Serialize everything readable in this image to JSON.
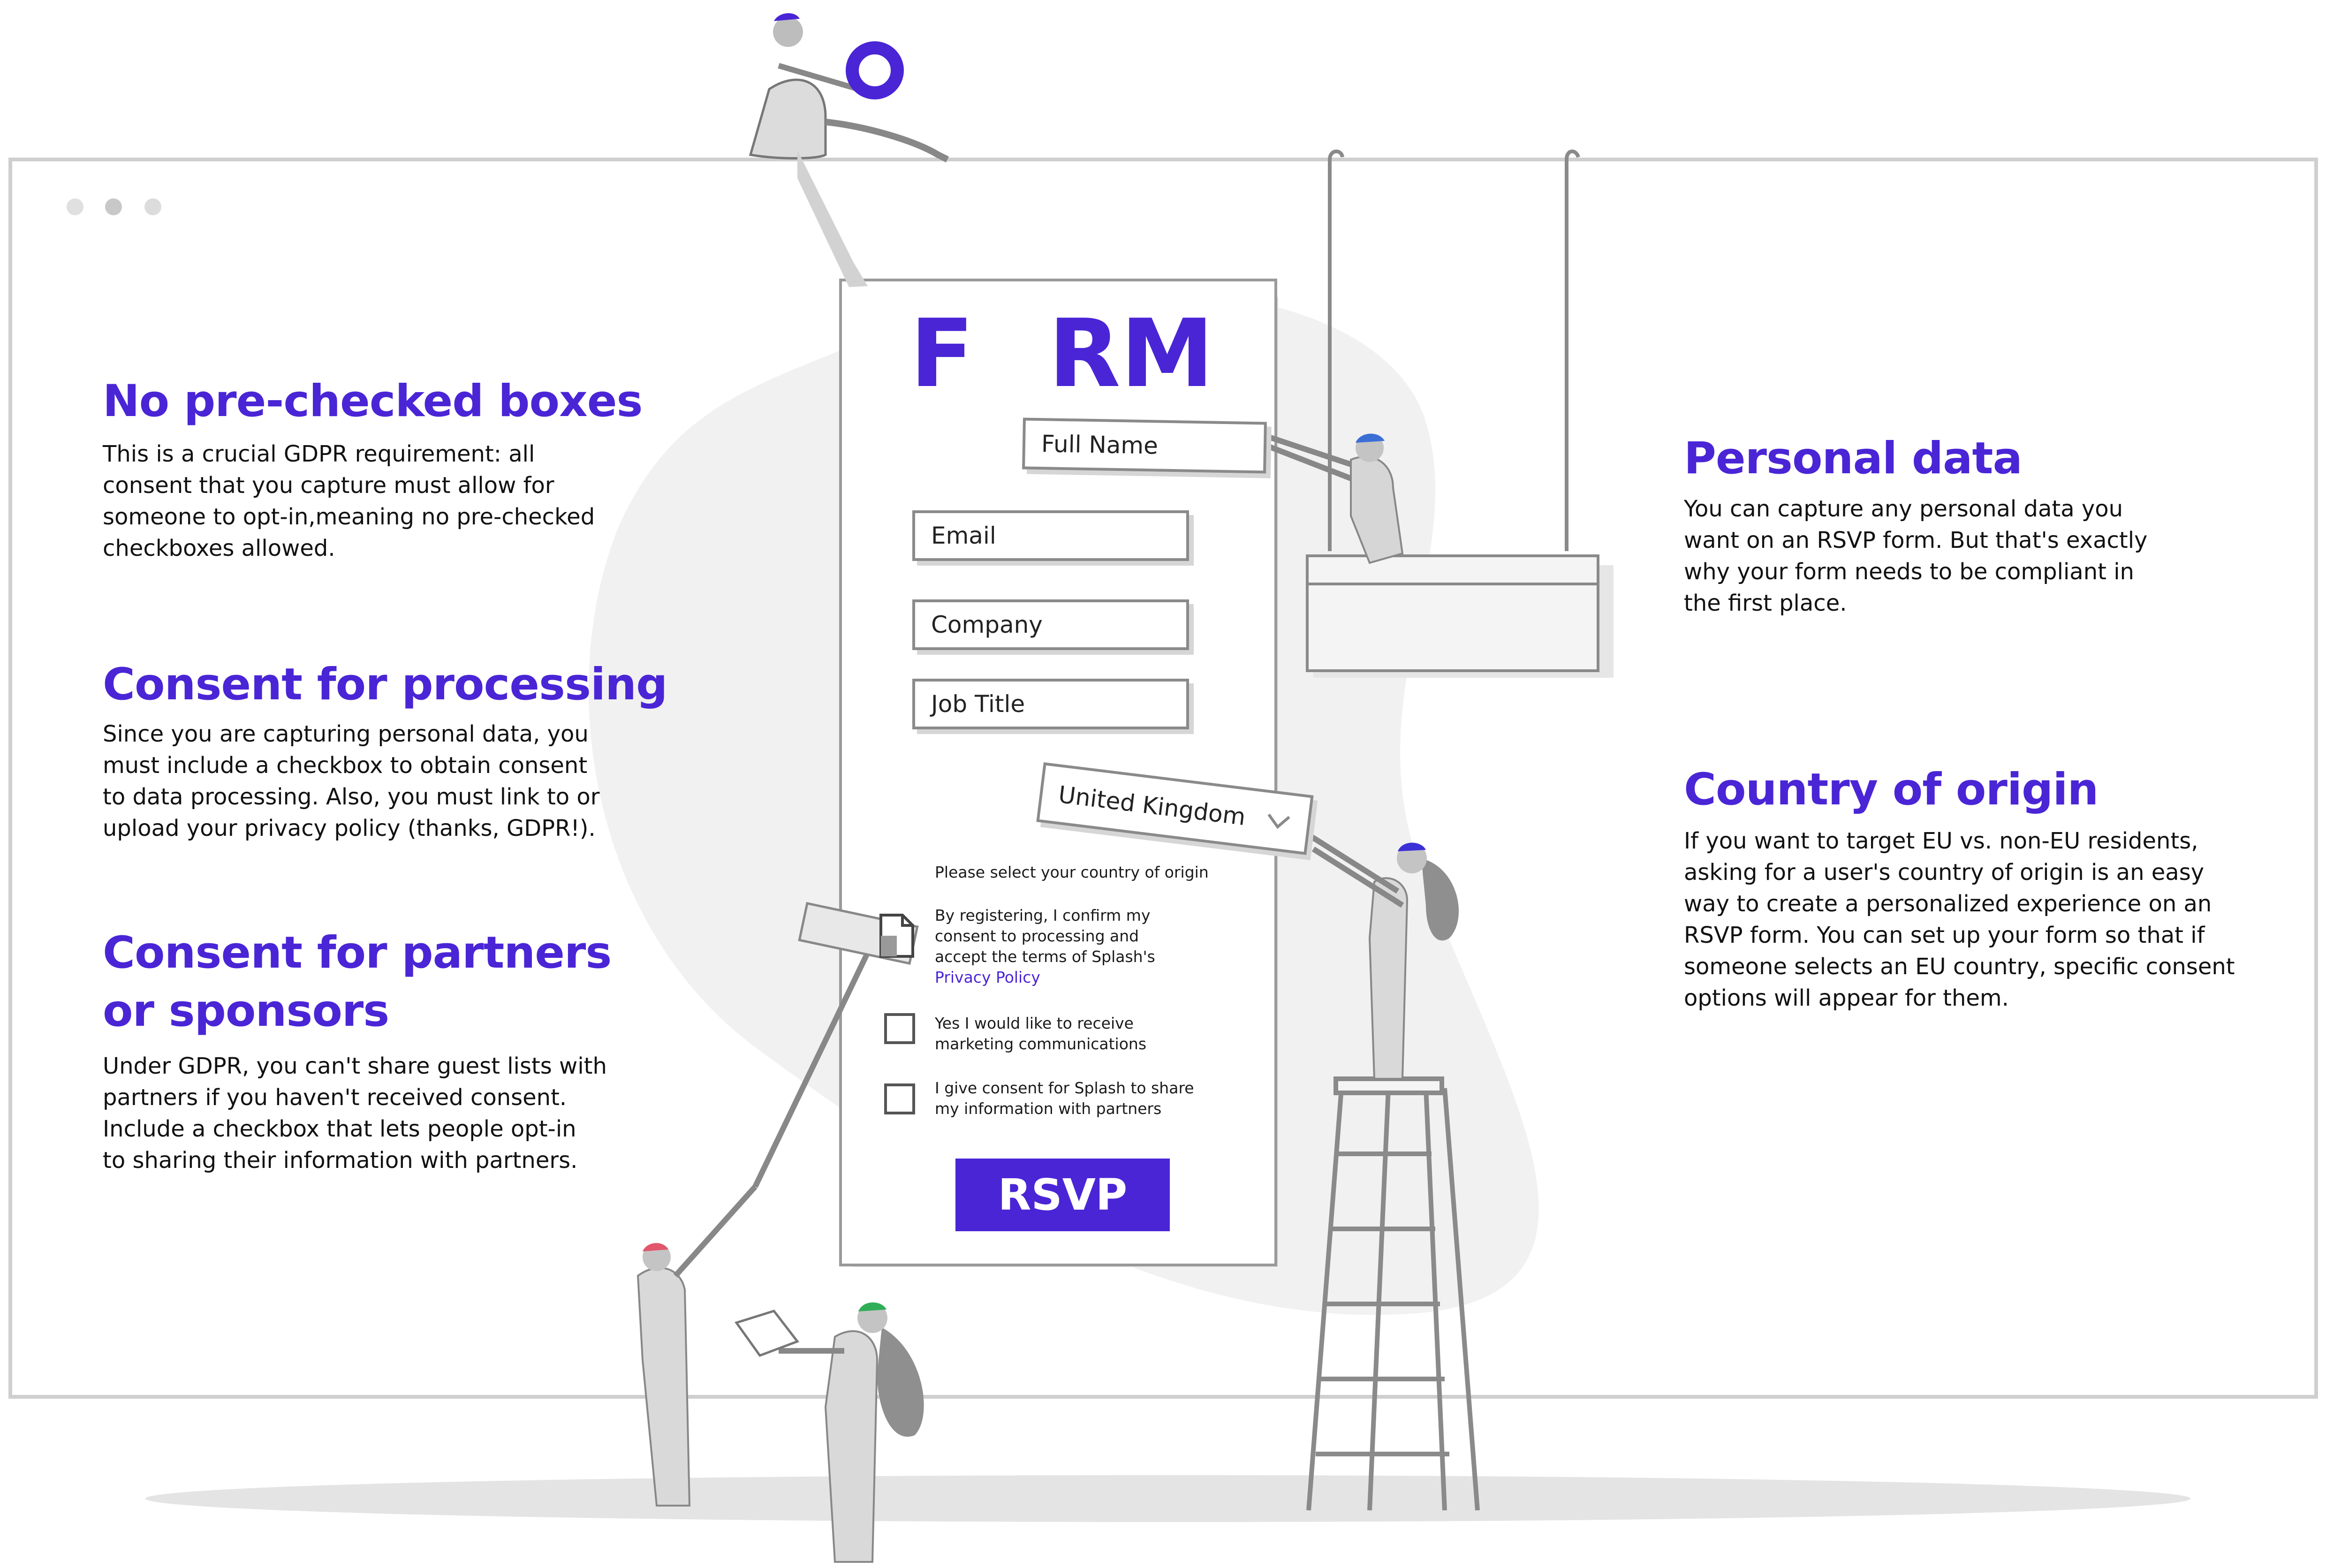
{
  "colors": {
    "accent": "#4a25d6",
    "outline": "#8a8a8a",
    "backdrop": "#f0f0f0",
    "shadow": "#dddddd"
  },
  "window": {
    "dots": [
      "dot",
      "dot",
      "dot"
    ]
  },
  "sections_left": [
    {
      "heading": [
        "No pre-checked boxes"
      ],
      "body": [
        "This is a crucial GDPR requirement: all",
        "consent that you capture must allow for",
        "someone to opt-in,meaning no pre-checked",
        "checkboxes allowed."
      ]
    },
    {
      "heading": [
        "Consent for processing"
      ],
      "body": [
        "Since you are capturing personal data, you",
        "must include a checkbox to obtain consent",
        "to data processing. Also, you must link to or",
        "upload your privacy policy (thanks, GDPR!)."
      ]
    },
    {
      "heading": [
        "Consent for partners",
        "or sponsors"
      ],
      "body": [
        "Under GDPR, you can't share guest lists with",
        "partners if you haven't received consent.",
        "Include a checkbox that lets people opt-in",
        "to sharing their information with partners."
      ]
    }
  ],
  "sections_right": [
    {
      "heading": [
        "Personal data"
      ],
      "body": [
        "You can capture any personal data you",
        "want on an RSVP form. But that's exactly",
        "why your form needs to be compliant in",
        "the first place."
      ]
    },
    {
      "heading": [
        "Country of origin"
      ],
      "body": [
        "If you want to target EU vs. non-EU residents,",
        "asking for a user's country of origin is an easy",
        "way to create a personalized experience on an",
        "RSVP form. You can set up your form so that if",
        "someone selects an EU country, specific consent",
        "options will appear for them."
      ]
    }
  ],
  "form": {
    "title_left": "F",
    "title_right": "RM",
    "fields": {
      "full_name": "Full Name",
      "email": "Email",
      "company": "Company",
      "job_title": "Job Title"
    },
    "country": {
      "value": "United Kingdom",
      "icon": "chevron-down-icon"
    },
    "country_hint": "Please select your country of origin",
    "terms": [
      "By registering, I confirm my",
      "consent to processing and",
      "accept the terms of Splash's"
    ],
    "privacy_link": "Privacy Policy",
    "checkbox_marketing": [
      "Yes I would like to receive",
      "marketing communications"
    ],
    "checkbox_partners": [
      "I give consent for Splash to share",
      "my information with partners"
    ],
    "rsvp": "RSVP"
  }
}
